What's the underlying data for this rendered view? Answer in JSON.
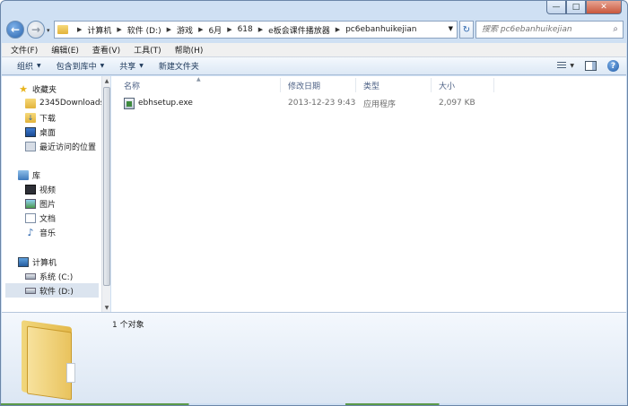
{
  "window": {
    "caption": {
      "minimize": "—",
      "maximize": "□",
      "close": "✕"
    }
  },
  "address": {
    "crumbs": [
      "计算机",
      "软件 (D:)",
      "游戏",
      "6月",
      "618",
      "e板会课件播放器",
      "pc6ebanhuikejian"
    ],
    "search_placeholder": "搜索 pc6ebanhuikejian"
  },
  "menubar": {
    "items": [
      "文件(F)",
      "编辑(E)",
      "查看(V)",
      "工具(T)",
      "帮助(H)"
    ]
  },
  "toolbar": {
    "organize": "组织",
    "include_in_library": "包含到库中",
    "share": "共享",
    "new_folder": "新建文件夹"
  },
  "navpane": {
    "favorites": {
      "label": "收藏夹",
      "items": [
        "2345Downloads",
        "下载",
        "桌面",
        "最近访问的位置"
      ]
    },
    "libraries": {
      "label": "库",
      "items": [
        "视频",
        "图片",
        "文档",
        "音乐"
      ]
    },
    "computer": {
      "label": "计算机",
      "items": [
        "系统 (C:)",
        "软件 (D:)"
      ]
    }
  },
  "columns": {
    "name": "名称",
    "date": "修改日期",
    "type": "类型",
    "size": "大小"
  },
  "files": [
    {
      "name": "ebhsetup.exe",
      "date": "2013-12-23 9:43",
      "type": "应用程序",
      "size": "2,097 KB"
    }
  ],
  "details": {
    "count": "1 个对象"
  }
}
